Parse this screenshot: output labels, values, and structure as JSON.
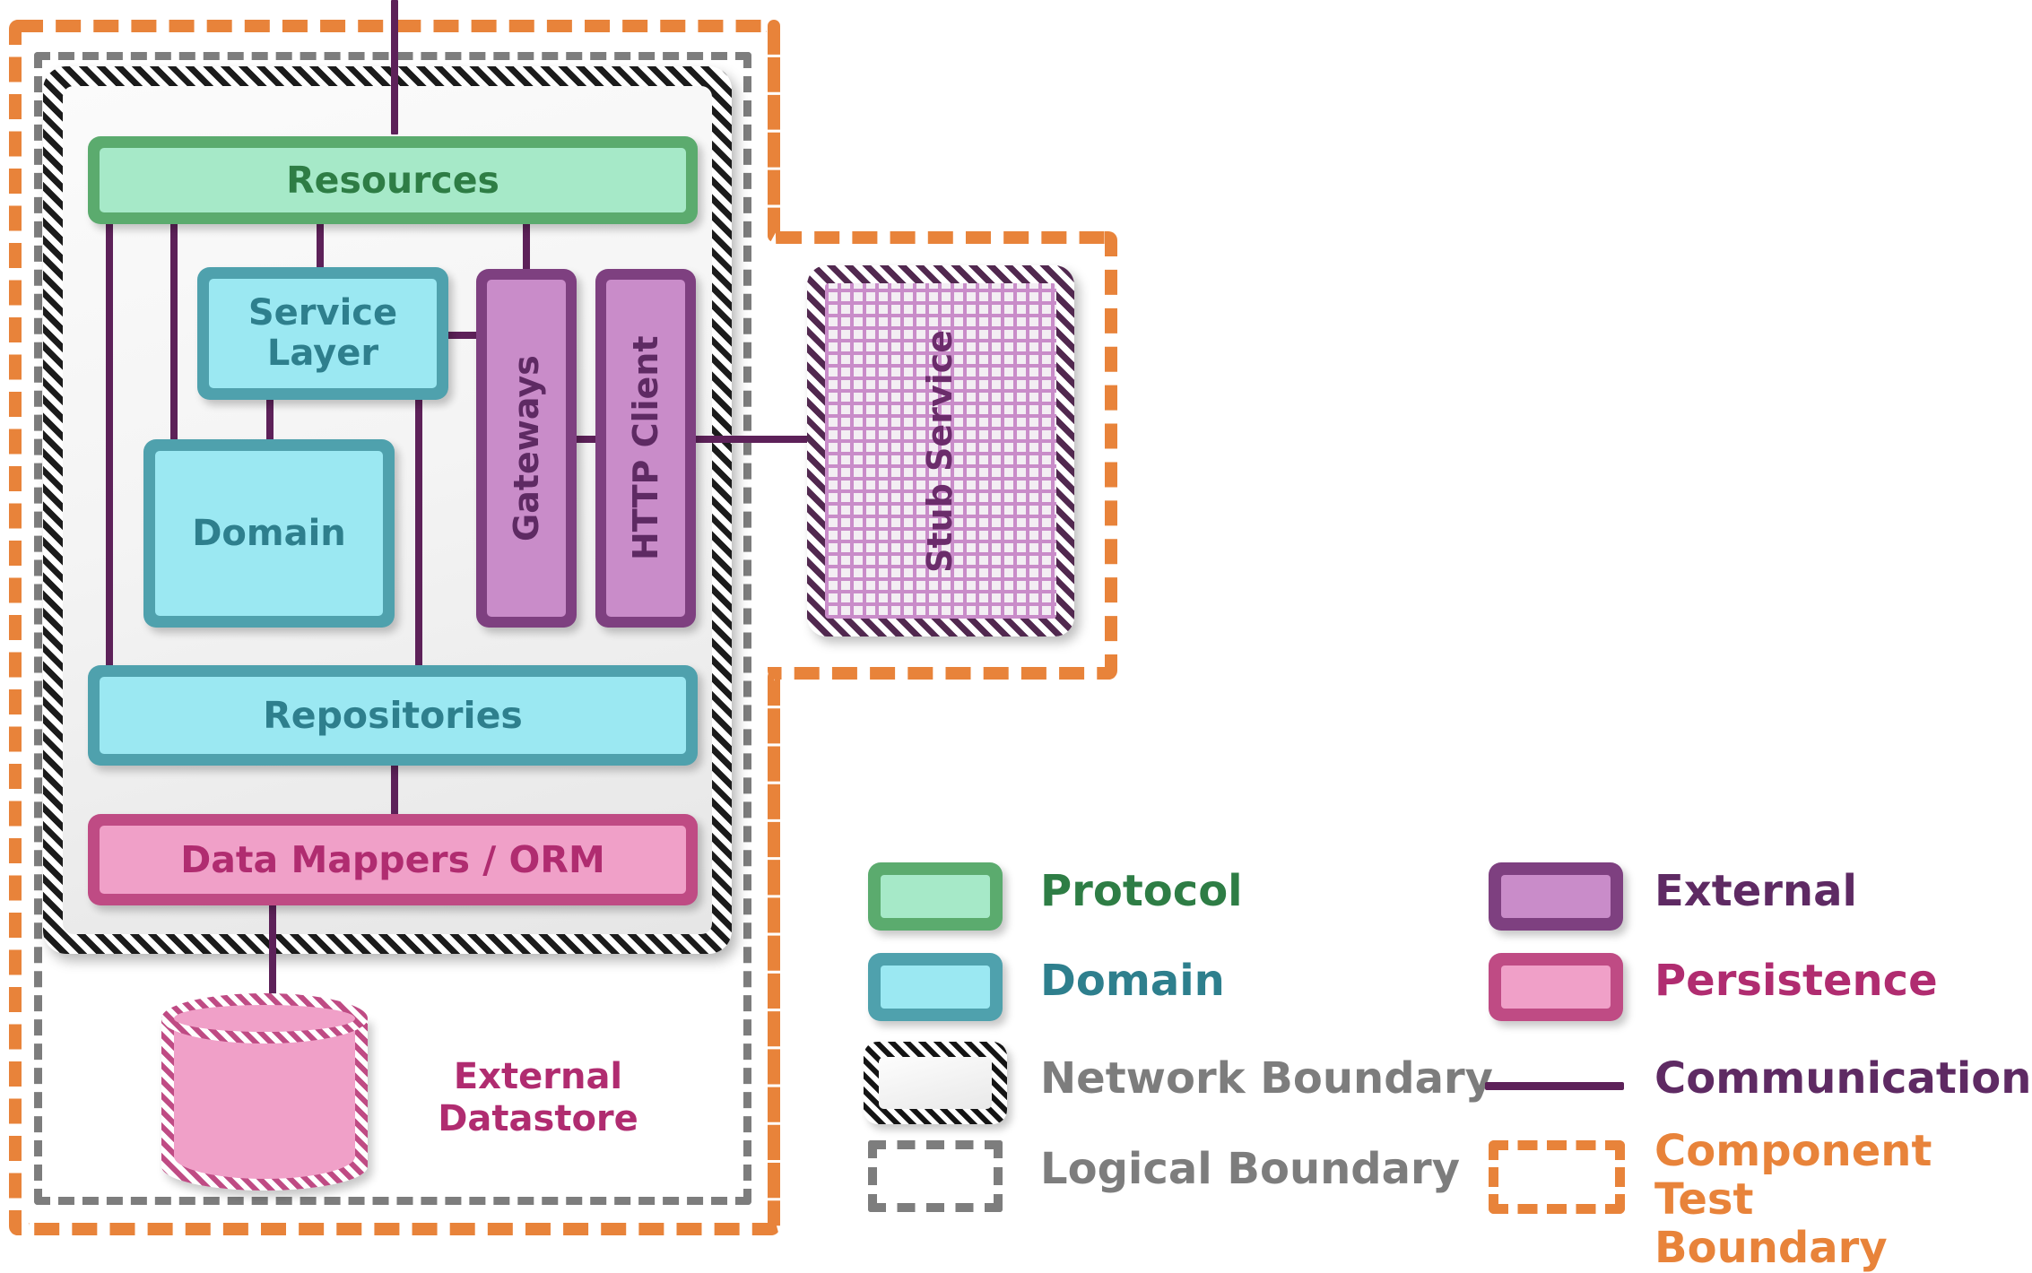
{
  "diagram": {
    "title": "Component Test Boundary Architecture Diagram",
    "nodes": {
      "resources": "Resources",
      "service_layer": "Service\nLayer",
      "domain": "Domain",
      "gateways": "Gateways",
      "http_client": "HTTP Client",
      "repositories": "Repositories",
      "data_mappers": "Data Mappers / ORM",
      "stub_service": "Stub\nService",
      "external_datastore": "External\nDatastore"
    }
  },
  "legend": {
    "items": [
      {
        "key": "protocol",
        "label": "Protocol",
        "swatch": "filled-box",
        "color": "#2e7d45"
      },
      {
        "key": "domain",
        "label": "Domain",
        "swatch": "filled-box",
        "color": "#2e7f8d"
      },
      {
        "key": "network",
        "label": "Network Boundary",
        "swatch": "hatched-box",
        "color": "#7d7d7d"
      },
      {
        "key": "logical",
        "label": "Logical Boundary",
        "swatch": "dashdot-box",
        "color": "#7d7d7d"
      },
      {
        "key": "external",
        "label": "External",
        "swatch": "filled-box",
        "color": "#5e2a63"
      },
      {
        "key": "persistence",
        "label": "Persistence",
        "swatch": "filled-box",
        "color": "#b02c70"
      },
      {
        "key": "communication",
        "label": "Communication",
        "swatch": "line",
        "color": "#5e2a63"
      },
      {
        "key": "component_test",
        "label": "Component Test\nBoundary",
        "swatch": "dashed-box",
        "color": "#e8833a"
      }
    ]
  },
  "colors": {
    "protocol_fill": "#a6e9c8",
    "protocol_border": "#5bab6e",
    "protocol_text": "#2e7d45",
    "domain_fill": "#9be8f2",
    "domain_border": "#4fa1ad",
    "domain_text": "#2e7f8d",
    "external_fill": "#c98cc9",
    "external_border": "#7e4080",
    "external_text": "#5e2a63",
    "persistence_fill": "#f0a0c8",
    "persistence_border": "#bf4b84",
    "persistence_text": "#b02c70",
    "communication_line": "#5d2159",
    "network_boundary": "#1b1b1b",
    "logical_boundary": "#7d7d7d",
    "component_test_boundary": "#e8833a"
  }
}
